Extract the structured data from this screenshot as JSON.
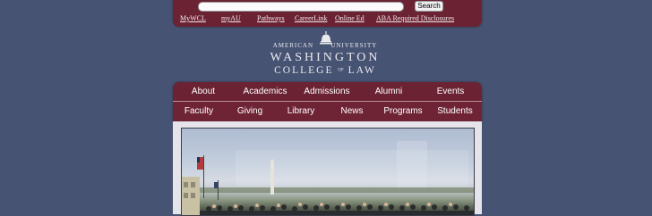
{
  "search": {
    "placeholder": "",
    "button_label": "Search"
  },
  "quicklinks": [
    {
      "label": "MyWCL"
    },
    {
      "label": "myAU"
    },
    {
      "label": "Pathways"
    },
    {
      "label": "CareerLink"
    },
    {
      "label": "Online Ed"
    },
    {
      "label": "ABA Required Disclosures"
    }
  ],
  "logo": {
    "line1_left": "AMERICAN",
    "line1_right": "UNIVERSITY",
    "line2": "WASHINGTON",
    "line3_a": "COLLEGE",
    "line3_of": "OF",
    "line3_b": "LAW"
  },
  "nav": {
    "primary": [
      {
        "label": "About"
      },
      {
        "label": "Academics"
      },
      {
        "label": "Admissions"
      },
      {
        "label": "Alumni"
      },
      {
        "label": "Events"
      }
    ],
    "secondary": [
      {
        "label": "Faculty"
      },
      {
        "label": "Giving"
      },
      {
        "label": "Library"
      },
      {
        "label": "News"
      },
      {
        "label": "Programs"
      },
      {
        "label": "Students"
      }
    ]
  },
  "colors": {
    "page_bg": "#475373",
    "brand_maroon": "#6b2334",
    "content_bg": "#e4e4ea"
  },
  "icons": {
    "logo_mark": "capitol-dome-icon"
  }
}
